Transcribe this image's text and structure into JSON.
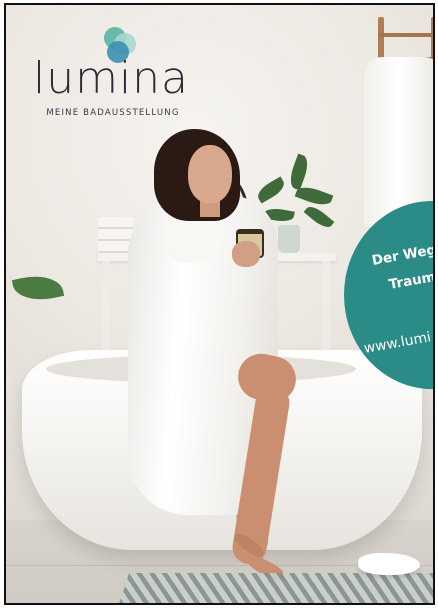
{
  "brand": {
    "name": "lumina",
    "tagline": "MEINE BADAUSSTELLUNG",
    "logo_colors": [
      "#5fb8a8",
      "#3c8fb0",
      "#a7d8cf"
    ]
  },
  "badge": {
    "line1": "Der Weg",
    "line2": "Traum",
    "url": "www.lumi",
    "color": "#2b8b87"
  }
}
